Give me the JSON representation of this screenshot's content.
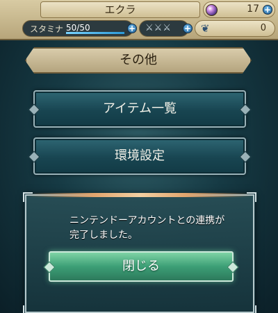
{
  "header": {
    "player_name": "エクラ",
    "orbs": "17",
    "stamina_label": "スタミナ",
    "stamina_value": "50/50",
    "stamina_fraction": 1.0,
    "feathers": "0",
    "plus_symbol": "+",
    "swords_glyphs": "⚔⚔⚔"
  },
  "title": "その他",
  "menu": {
    "items_label": "アイテム一覧",
    "settings_label": "環境設定"
  },
  "dialog": {
    "message": "ニンテンドーアカウントとの連携が完了しました。",
    "close_label": "閉じる"
  },
  "colors": {
    "accent_green": "#3c9f76",
    "panel_teal": "#184551",
    "header_parchment": "#d8cba3"
  }
}
